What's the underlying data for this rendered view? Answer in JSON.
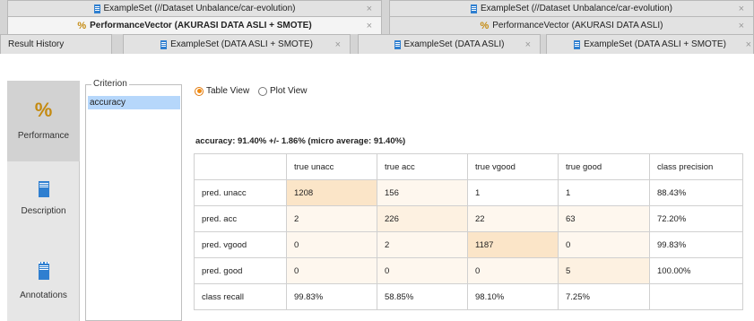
{
  "top_tabs": [
    {
      "label": "ExampleSet (//Dataset Unbalance/car-evolution)",
      "icon": "document-icon"
    },
    {
      "label": "ExampleSet (//Dataset Unbalance/car-evolution)",
      "icon": "document-icon"
    }
  ],
  "second_tabs": [
    {
      "label": "PerformanceVector (AKURASI DATA ASLI + SMOTE)",
      "icon": "percent-icon",
      "active": true
    },
    {
      "label": "PerformanceVector (AKURASI DATA ASLI)",
      "icon": "percent-icon"
    }
  ],
  "third_row": {
    "result_history": "Result History",
    "tabs": [
      {
        "label": "ExampleSet (DATA ASLI + SMOTE)",
        "icon": "document-icon"
      },
      {
        "label": "ExampleSet (DATA ASLI)",
        "icon": "document-icon"
      },
      {
        "label": "ExampleSet (DATA ASLI + SMOTE)",
        "icon": "document-icon"
      }
    ]
  },
  "close_glyph": "×",
  "sidebar": [
    {
      "label": "Performance",
      "icon": "percent-icon",
      "active": true
    },
    {
      "label": "Description",
      "icon": "description-icon"
    },
    {
      "label": "Annotations",
      "icon": "annotations-icon"
    }
  ],
  "criterion": {
    "legend": "Criterion",
    "items": [
      "accuracy"
    ]
  },
  "view_options": {
    "table": "Table View",
    "plot": "Plot View",
    "selected": "table"
  },
  "summary": "accuracy: 91.40% +/- 1.86% (micro average: 91.40%)",
  "table": {
    "headers": [
      "",
      "true unacc",
      "true acc",
      "true vgood",
      "true good",
      "class precision"
    ],
    "rows": [
      [
        "pred. unacc",
        "1208",
        "156",
        "1",
        "1",
        "88.43%"
      ],
      [
        "pred. acc",
        "2",
        "226",
        "22",
        "63",
        "72.20%"
      ],
      [
        "pred. vgood",
        "0",
        "2",
        "1187",
        "0",
        "99.83%"
      ],
      [
        "pred. good",
        "0",
        "0",
        "0",
        "5",
        "100.00%"
      ],
      [
        "class recall",
        "99.83%",
        "58.85%",
        "98.10%",
        "7.25%",
        ""
      ]
    ]
  },
  "colors": {
    "highlight_strong": "#fbe5c8",
    "highlight_mid": "#fdf1e1",
    "highlight_light": "#fef7ee",
    "selection": "#b6d7fb",
    "accent": "#f08a10"
  }
}
